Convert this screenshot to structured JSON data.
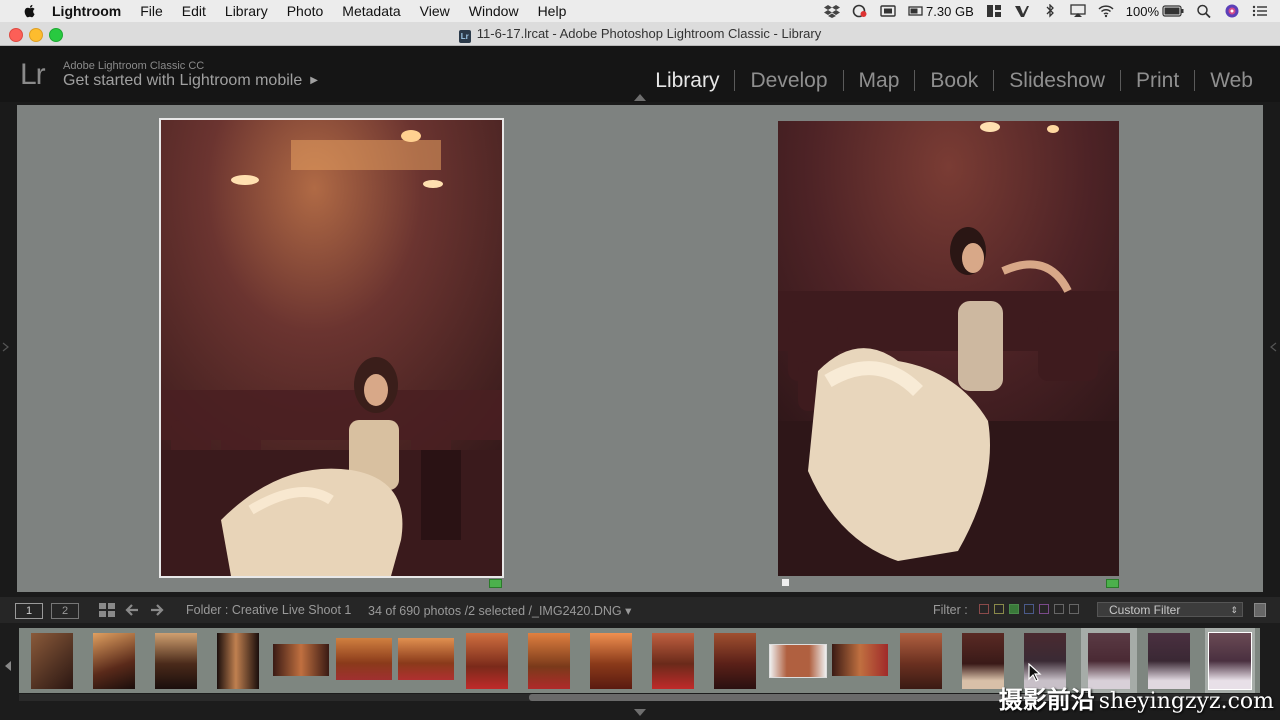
{
  "menubar": {
    "app": "Lightroom",
    "items": [
      "File",
      "Edit",
      "Library",
      "Photo",
      "Metadata",
      "View",
      "Window",
      "Help"
    ],
    "storage": "7.30 GB",
    "battery": "100%"
  },
  "window": {
    "title": "11-6-17.lrcat - Adobe Photoshop Lightroom Classic - Library"
  },
  "identity": {
    "logo": "Lr",
    "line1": "Adobe Lightroom Classic CC",
    "line2": "Get started with Lightroom mobile",
    "arrow": "▶"
  },
  "modules": [
    "Library",
    "Develop",
    "Map",
    "Book",
    "Slideshow",
    "Print",
    "Web"
  ],
  "active_module": "Library",
  "toolbar": {
    "view1": "1",
    "view2": "2",
    "folder": "Folder : Creative Live Shoot 1",
    "count": "34 of 690 photos /2 selected /_IMG2420.DNG",
    "count_caret": "▾",
    "filter_label": "Filter :",
    "custom_filter": "Custom Filter",
    "custom_chev": "⇕"
  },
  "filmstrip": {
    "thumbs": 20,
    "selected": [
      16,
      19
    ]
  },
  "watermark": {
    "zh": "摄影前沿",
    "en": "sheyingzyz.com"
  },
  "colors": {
    "canvas": "#7e8280",
    "pick_flag": "#4cb04c",
    "filmstrip_bg": "#7e8680"
  }
}
